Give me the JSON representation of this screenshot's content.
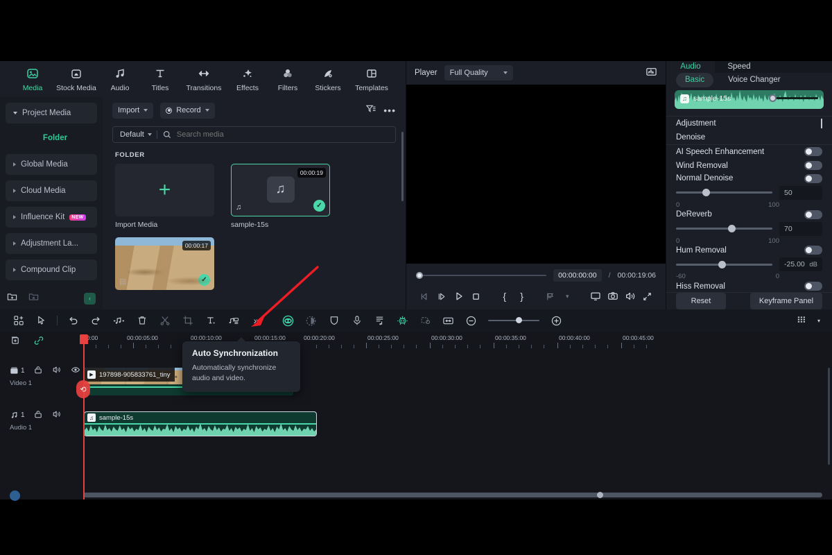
{
  "nav_tabs": [
    {
      "label": "Media",
      "icon": "media-icon",
      "active": true
    },
    {
      "label": "Stock Media",
      "icon": "stock-media-icon",
      "active": false
    },
    {
      "label": "Audio",
      "icon": "audio-note-icon",
      "active": false
    },
    {
      "label": "Titles",
      "icon": "titles-t-icon",
      "active": false
    },
    {
      "label": "Transitions",
      "icon": "transitions-icon",
      "active": false
    },
    {
      "label": "Effects",
      "icon": "effects-sparkle-icon",
      "active": false
    },
    {
      "label": "Filters",
      "icon": "filters-circles-icon",
      "active": false
    },
    {
      "label": "Stickers",
      "icon": "stickers-icon",
      "active": false
    },
    {
      "label": "Templates",
      "icon": "templates-grid-icon",
      "active": false
    }
  ],
  "tree": {
    "items": [
      {
        "label": "Project Media",
        "expanded": true,
        "badge": null
      },
      {
        "label": "Folder",
        "child": true,
        "badge": null
      },
      {
        "label": "Global Media",
        "expanded": false,
        "badge": null
      },
      {
        "label": "Cloud Media",
        "expanded": false,
        "badge": null
      },
      {
        "label": "Influence Kit",
        "expanded": false,
        "badge": "NEW"
      },
      {
        "label": "Adjustment La...",
        "expanded": false,
        "badge": null
      },
      {
        "label": "Compound Clip",
        "expanded": false,
        "badge": null
      }
    ],
    "footer": {
      "new_folder": "new-folder-icon",
      "delete_folder": "delete-folder-icon",
      "collapse": "collapse-chevron-icon"
    }
  },
  "browser": {
    "import_label": "Import",
    "record_label": "Record",
    "filter_icon": "filter-icon",
    "more_icon": "more-options-icon",
    "sort_label": "Default",
    "search_placeholder": "Search media",
    "search_value": "",
    "section_label": "FOLDER",
    "items": [
      {
        "name": "Import Media",
        "type": "import",
        "duration": null,
        "selected": false
      },
      {
        "name": "sample-15s",
        "type": "audio",
        "duration": "00:00:19",
        "selected": true
      },
      {
        "name": "",
        "type": "video",
        "duration": "00:00:17",
        "selected": true
      }
    ]
  },
  "player": {
    "title": "Player",
    "quality": "Full Quality",
    "scope_icon": "waveform-scope-icon",
    "current_time": "00:00:00:00",
    "separator": "/",
    "total_time": "00:00:19:06",
    "buttons": [
      {
        "name": "prev-frame-button",
        "glyph": "◁|"
      },
      {
        "name": "next-frame-button",
        "glyph": "|▷"
      },
      {
        "name": "play-button",
        "glyph": "▷"
      },
      {
        "name": "stop-button",
        "glyph": "□"
      },
      {
        "name": "mark-in-button",
        "glyph": "{"
      },
      {
        "name": "mark-out-button",
        "glyph": "}"
      },
      {
        "name": "markers-button",
        "glyph": "⊨"
      },
      {
        "name": "markers-dropdown",
        "glyph": "⌄"
      },
      {
        "name": "display-button",
        "glyph": "▭"
      },
      {
        "name": "snapshot-button",
        "glyph": "◎"
      },
      {
        "name": "volume-button",
        "glyph": "◁)"
      },
      {
        "name": "fullscreen-button",
        "glyph": "⤢"
      }
    ]
  },
  "properties": {
    "tabs": [
      {
        "label": "Audio",
        "active": true
      },
      {
        "label": "Speed",
        "active": false
      }
    ],
    "subtabs": [
      {
        "label": "Basic",
        "active": true
      },
      {
        "label": "Voice Changer",
        "active": false
      }
    ],
    "clip_name": "sample-15s",
    "sections": [
      {
        "label": "Adjustment",
        "control": "keyframe-diamond"
      },
      {
        "label": "Denoise",
        "control": "none"
      }
    ],
    "controls": [
      {
        "label": "AI Speech Enhancement",
        "toggle": false,
        "slider": null
      },
      {
        "label": "Wind Removal",
        "toggle": false,
        "slider": null
      },
      {
        "label": "Normal Denoise",
        "toggle": false,
        "slider": {
          "value": "50",
          "min": "0",
          "max": "100",
          "pct": 30,
          "unit": ""
        }
      },
      {
        "label": "DeReverb",
        "toggle": false,
        "slider": {
          "value": "70",
          "min": "0",
          "max": "100",
          "pct": 57,
          "unit": ""
        }
      },
      {
        "label": "Hum Removal",
        "toggle": false,
        "slider": {
          "value": "-25.00",
          "min": "-60",
          "max": "0",
          "pct": 47,
          "unit": "dB"
        }
      },
      {
        "label": "Hiss Removal",
        "toggle": false,
        "slider": null
      }
    ],
    "reset_label": "Reset",
    "keyframe_label": "Keyframe Panel"
  },
  "timeline_toolbar": {
    "buttons": [
      {
        "name": "templates-button",
        "glyph": "▣"
      },
      {
        "name": "select-tool-button",
        "glyph": "➤"
      },
      {
        "name": "undo-button",
        "glyph": "↩"
      },
      {
        "name": "redo-button",
        "glyph": "↪"
      },
      {
        "name": "audio-split-button",
        "glyph": "♪"
      },
      {
        "name": "delete-button",
        "glyph": "🗑"
      },
      {
        "name": "split-button",
        "glyph": "✂"
      },
      {
        "name": "crop-button",
        "glyph": "⛶"
      },
      {
        "name": "text-button",
        "glyph": "T"
      },
      {
        "name": "auto-sync-button",
        "glyph": "⎋"
      },
      {
        "name": "more-tools-button",
        "glyph": "»"
      },
      {
        "name": "green-screen-button",
        "glyph": "◉"
      },
      {
        "name": "color-match-button",
        "glyph": "◑"
      },
      {
        "name": "mask-button",
        "glyph": "⬭"
      },
      {
        "name": "voiceover-button",
        "glyph": "🎙"
      },
      {
        "name": "subtitle-button",
        "glyph": "≣"
      },
      {
        "name": "ai-tools-button",
        "glyph": "✳"
      },
      {
        "name": "marker-button",
        "glyph": "▤"
      },
      {
        "name": "fit-button",
        "glyph": "↔"
      },
      {
        "name": "zoom-out-button",
        "glyph": "⊖"
      },
      {
        "name": "zoom-in-button",
        "glyph": "⊕"
      },
      {
        "name": "track-height-button",
        "glyph": "▦"
      },
      {
        "name": "track-height-caret",
        "glyph": "▾"
      }
    ]
  },
  "tooltip": {
    "title": "Auto Synchronization",
    "body": "Automatically synchronize audio and video."
  },
  "timeline": {
    "header_icons": [
      {
        "name": "add-track-icon"
      },
      {
        "name": "link-icon"
      }
    ],
    "ruler_ticks": [
      "00:00",
      "00:00:05:00",
      "00:00:10:00",
      "00:00:15:00",
      "00:00:20:00",
      "00:00:25:00",
      "00:00:30:00",
      "00:00:35:00",
      "00:00:40:00",
      "00:00:45:00"
    ],
    "tracks": [
      {
        "type": "video",
        "number": "1",
        "label": "Video 1",
        "clip": "197898-905833761_tiny"
      },
      {
        "type": "audio",
        "number": "1",
        "label": "Audio 1",
        "clip": "sample-15s"
      }
    ]
  },
  "colors": {
    "accent": "#3ed0a4",
    "panel": "#1b1e26",
    "app_bg": "#14161c",
    "playhead": "#e8413f",
    "annotation": "#ee1c25"
  }
}
